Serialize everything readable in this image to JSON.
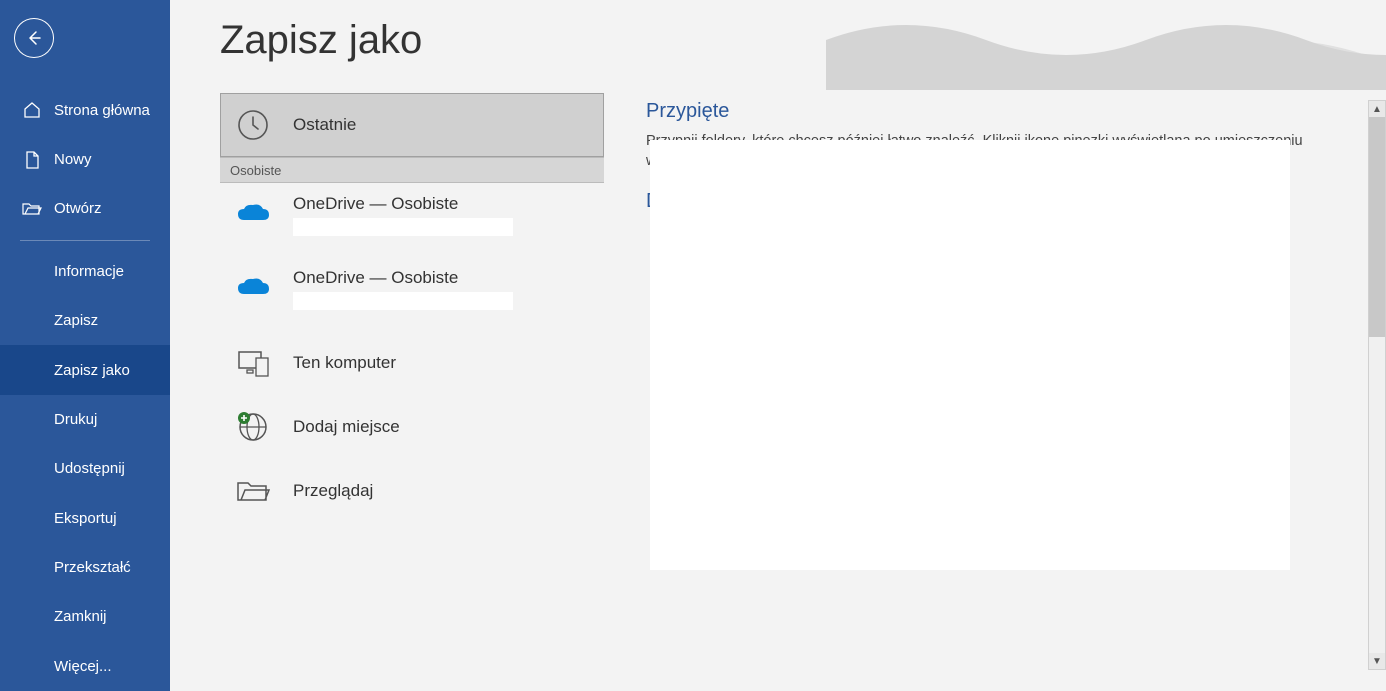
{
  "colors": {
    "brand": "#2b579a",
    "brand_dark": "#19478a"
  },
  "page_title": "Zapisz jako",
  "sidebar": {
    "items": [
      {
        "id": "home",
        "label": "Strona główna",
        "icon": "home-icon"
      },
      {
        "id": "new",
        "label": "Nowy",
        "icon": "document-icon"
      },
      {
        "id": "open",
        "label": "Otwórz",
        "icon": "folder-open-icon"
      }
    ],
    "items2": [
      {
        "id": "info",
        "label": "Informacje"
      },
      {
        "id": "save",
        "label": "Zapisz"
      },
      {
        "id": "saveas",
        "label": "Zapisz jako",
        "selected": true
      },
      {
        "id": "print",
        "label": "Drukuj"
      },
      {
        "id": "share",
        "label": "Udostępnij"
      },
      {
        "id": "export",
        "label": "Eksportuj"
      },
      {
        "id": "transform",
        "label": "Przekształć"
      },
      {
        "id": "close",
        "label": "Zamknij"
      },
      {
        "id": "more",
        "label": "Więcej..."
      }
    ]
  },
  "locations": {
    "recent_label": "Ostatnie",
    "personal_header": "Osobiste",
    "onedrive1": "OneDrive — Osobiste",
    "onedrive2": "OneDrive — Osobiste",
    "this_pc": "Ten komputer",
    "add_place": "Dodaj miejsce",
    "browse": "Przeglądaj"
  },
  "right": {
    "pinned_title": "Przypięte",
    "pinned_desc": "Przypnij foldery, które chcesz później łatwo znaleźć. Kliknij ikonę pinezki wyświetlaną po umieszczeniu wskaźnika na folderze.",
    "today_title": "Dzisiaj"
  }
}
